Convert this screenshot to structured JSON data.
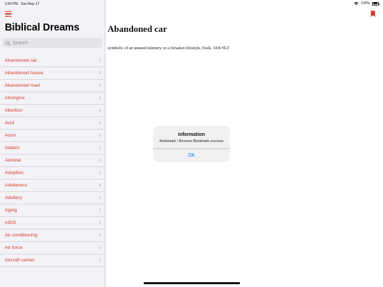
{
  "status_bar": {
    "time": "3:42 PM",
    "date": "Sun May 17",
    "battery": "100%",
    "battery_level": 1.0,
    "icons": [
      "wifi-icon",
      "battery-icon"
    ]
  },
  "sidebar": {
    "title": "Biblical Dreams",
    "menu_icon": "hamburger-menu-icon",
    "search": {
      "placeholder": "Search",
      "value": ""
    },
    "items": [
      {
        "label": "Abandoned car"
      },
      {
        "label": "Abandoned house"
      },
      {
        "label": "Abandoned road"
      },
      {
        "label": "Aborigine"
      },
      {
        "label": "Abortion"
      },
      {
        "label": "Acid"
      },
      {
        "label": "Actor"
      },
      {
        "label": "Adders"
      },
      {
        "label": "Admiral"
      },
      {
        "label": "Adoption"
      },
      {
        "label": "Adulteress"
      },
      {
        "label": "Adultery"
      },
      {
        "label": "Aging"
      },
      {
        "label": "AIDS"
      },
      {
        "label": "Air-conditioning"
      },
      {
        "label": "Air force"
      },
      {
        "label": "Aircraft carrier"
      }
    ]
  },
  "detail": {
    "title": "Abandoned car",
    "body": "symbolic of an unused ministry or a forsaken lifestyle, Ezek. 34:8 NLT",
    "bookmark_icon": "bookmark-icon"
  },
  "alert": {
    "title": "Information",
    "message": "Bookmark / Remove Bookmark success",
    "ok_label": "OK"
  },
  "colors": {
    "accent": "#d9362b",
    "link_blue": "#1479f5",
    "sidebar_bg": "#f2f2f7"
  }
}
